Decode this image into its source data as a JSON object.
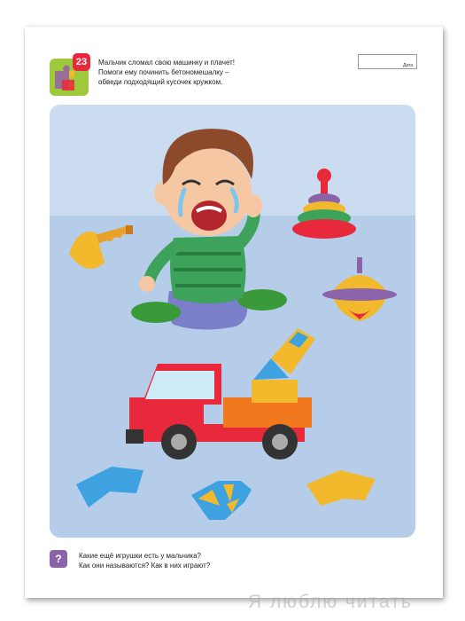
{
  "task": {
    "number": "23",
    "instruction_line1": "Мальчик сломал свою машинку и плачет!",
    "instruction_line2": "Помоги ему починить бетономешалку –",
    "instruction_line3": "обведи подходящий кусочек кружком."
  },
  "date": {
    "label": "Дата"
  },
  "question": {
    "icon": "?",
    "line1": "Какие ещё игрушки есть у мальчика?",
    "line2": "Как они называются? Как в них играют?"
  },
  "watermark": "Я  люблю читать",
  "colors": {
    "scene_background": "#cbdcf1",
    "floor": "#b6cde9",
    "task_badge": "#e8293b",
    "question_badge": "#8a63a8"
  }
}
